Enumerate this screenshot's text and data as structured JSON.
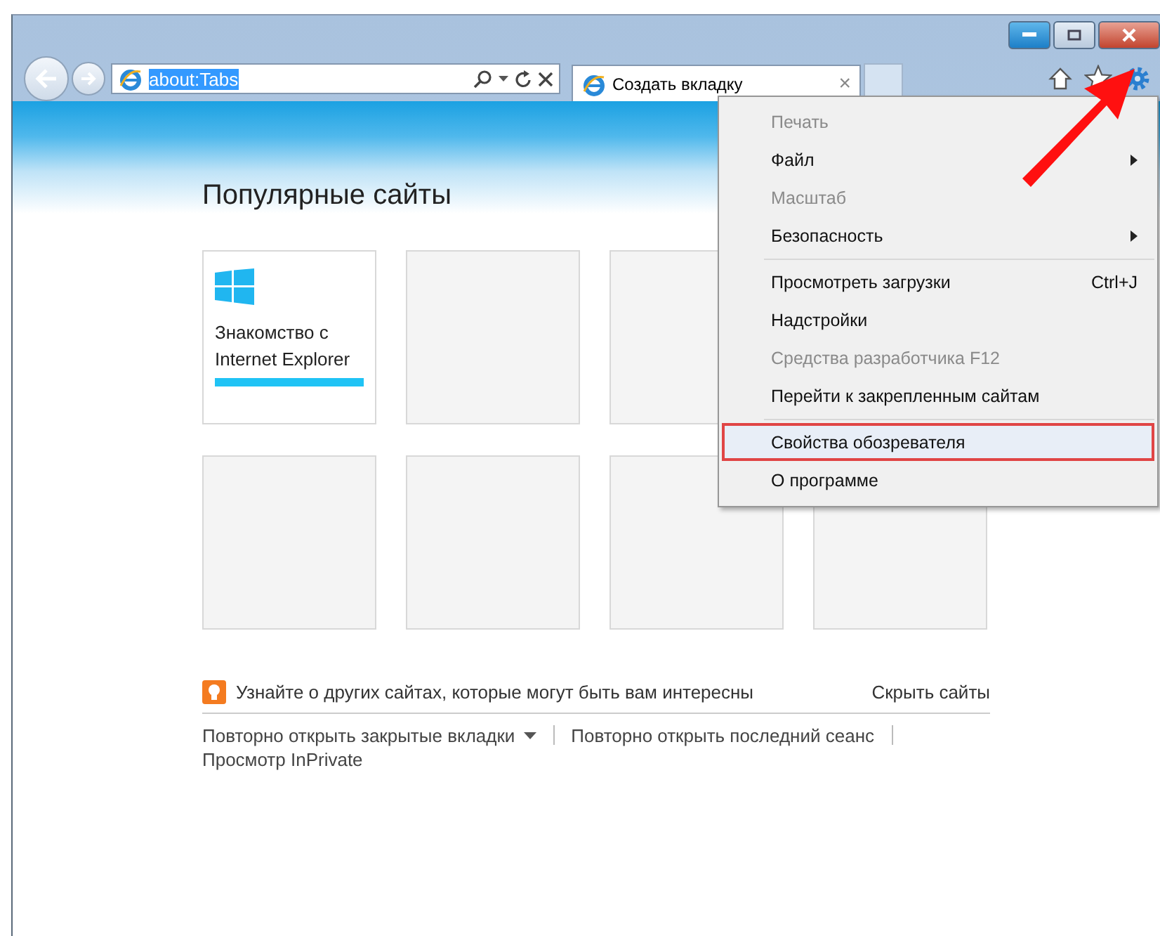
{
  "address_bar": {
    "value": "about:Tabs",
    "selected": true
  },
  "tabs": [
    {
      "title": "Создать вкладку",
      "close": "×",
      "selected": true
    }
  ],
  "page": {
    "heading": "Популярные сайты",
    "tile_rows": [
      [
        {
          "kind": "site",
          "title": "Знакомство с Internet Explorer"
        },
        {
          "kind": "empty"
        },
        {
          "kind": "empty"
        }
      ],
      [
        {
          "kind": "empty"
        },
        {
          "kind": "empty"
        },
        {
          "kind": "empty"
        },
        {
          "kind": "empty"
        }
      ]
    ],
    "suggest": {
      "text": "Узнайте о других сайтах, которые могут быть вам интересны",
      "hide": "Скрыть сайты"
    },
    "links": [
      {
        "label": "Повторно открыть закрытые вкладки",
        "dropdown": true
      },
      {
        "label": "Повторно открыть последний сеанс",
        "dropdown": false
      },
      {
        "label": "Просмотр InPrivate",
        "dropdown": false
      }
    ]
  },
  "menu": {
    "groups": [
      [
        {
          "label": "Печать",
          "disabled": true,
          "submenu": false,
          "selected": false
        },
        {
          "label": "Файл",
          "disabled": false,
          "submenu": true,
          "selected": false
        },
        {
          "label": "Масштаб",
          "disabled": true,
          "submenu": false,
          "selected": false
        },
        {
          "label": "Безопасность",
          "disabled": false,
          "submenu": true,
          "selected": false
        }
      ],
      [
        {
          "label": "Просмотреть загрузки",
          "shortcut": "Ctrl+J",
          "disabled": false,
          "submenu": false,
          "selected": false
        },
        {
          "label": "Надстройки",
          "disabled": false,
          "submenu": false,
          "selected": false
        },
        {
          "label": "Средства разработчика F12",
          "disabled": true,
          "submenu": false,
          "selected": false
        },
        {
          "label": "Перейти к закрепленным сайтам",
          "disabled": false,
          "submenu": false,
          "selected": false
        }
      ],
      [
        {
          "label": "Свойства обозревателя",
          "disabled": false,
          "submenu": false,
          "selected": true
        },
        {
          "label": "О программе",
          "disabled": false,
          "submenu": false,
          "selected": false
        }
      ]
    ]
  }
}
